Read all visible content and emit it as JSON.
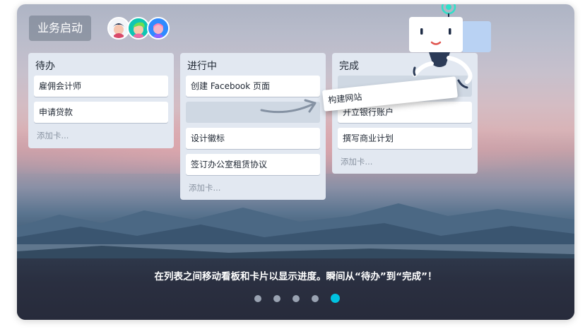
{
  "board": {
    "title": "业务启动"
  },
  "avatars": [
    {
      "name": "avatar-1-icon",
      "color": "#ffffff"
    },
    {
      "name": "avatar-2-icon",
      "color": "#0fc6b3"
    },
    {
      "name": "avatar-3-icon",
      "color": "#2f8bff"
    }
  ],
  "lists": [
    {
      "title": "待办",
      "cards": [
        "雇佣会计师",
        "申请贷款"
      ],
      "add_card": "添加卡..."
    },
    {
      "title": "进行中",
      "cards": [
        "创建 Facebook 页面",
        "设计徽标",
        "签订办公室租赁协议"
      ],
      "add_card": "添加卡..."
    },
    {
      "title": "完成",
      "cards": [
        "开立银行账户",
        "撰写商业计划"
      ],
      "add_card": "添加卡..."
    }
  ],
  "dragging_card": "构建网站",
  "caption": "在列表之间移动看板和卡片以显示进度。瞬间从“待办”到“完成”！",
  "carousel": {
    "count": 5,
    "active_index": 4
  },
  "colors": {
    "accent": "#00c2e0",
    "list_bg": "#e2e8f1"
  }
}
